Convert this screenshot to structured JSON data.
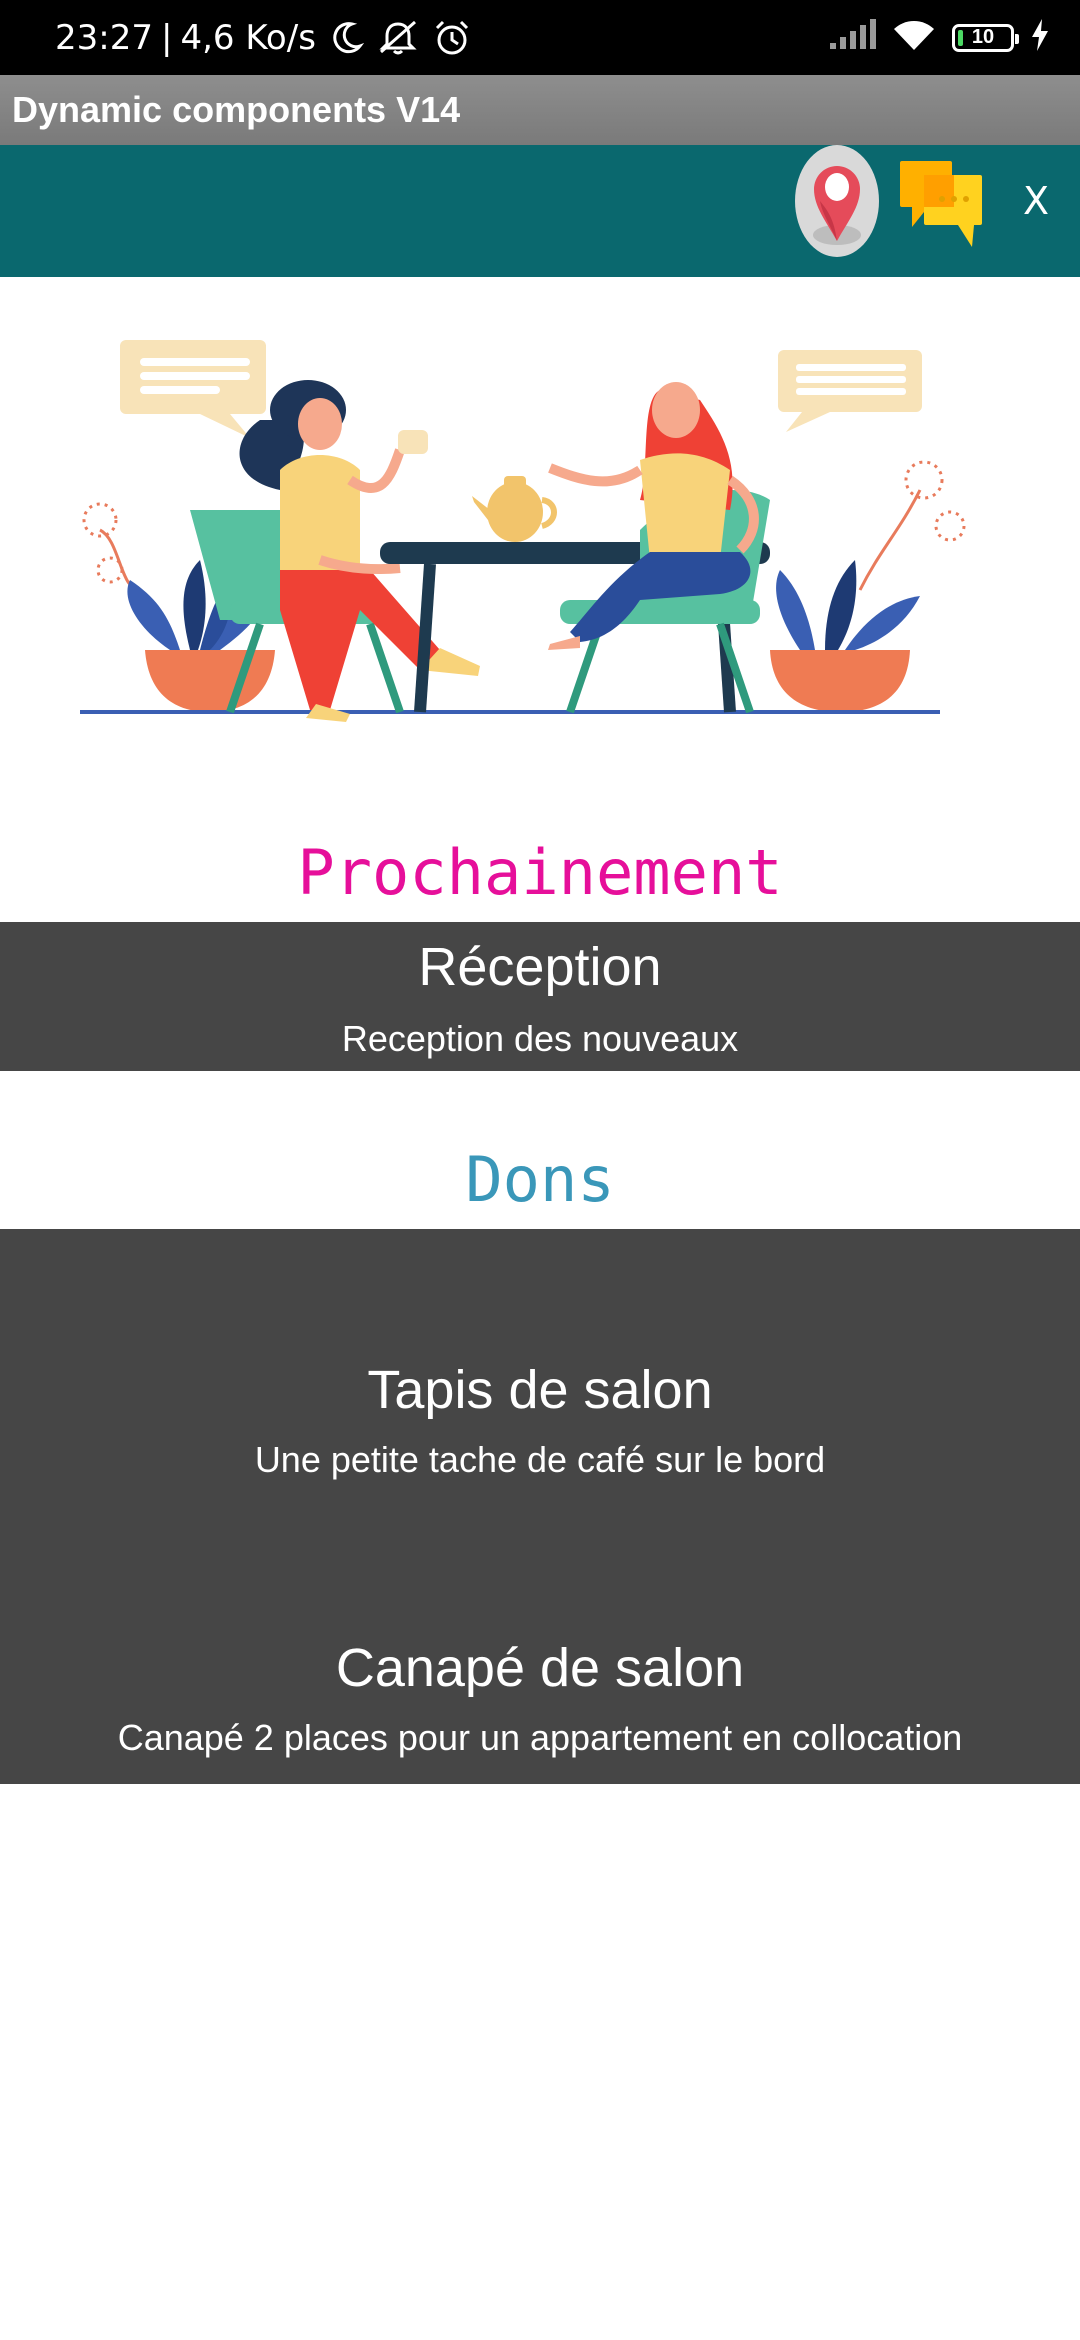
{
  "status_bar": {
    "time": "23:27",
    "separator": "|",
    "speed": "4,6 Ko/s",
    "battery_level": "10",
    "icons": [
      "moon-icon",
      "notifications-off-icon",
      "alarm-icon",
      "signal-icon",
      "wifi-icon",
      "battery-icon",
      "charging-icon"
    ]
  },
  "app_bar": {
    "title": "Dynamic components V14"
  },
  "toolbar": {
    "icons": [
      "map-pin-icon",
      "chat-bubbles-icon"
    ],
    "close_label": "X",
    "background_color": "#0a686e"
  },
  "sections": {
    "upcoming": {
      "heading": "Prochainement",
      "heading_color": "#e60f9a",
      "item": {
        "title": "Réception",
        "description": "Reception des nouveaux"
      }
    },
    "donations": {
      "heading": "Dons",
      "heading_color": "#3a97b9",
      "items": [
        {
          "title": "Tapis de salon",
          "description": "Une petite tache de café sur le bord"
        },
        {
          "title": "Canapé de salon",
          "description": "Canapé 2 places pour un appartement en collocation"
        }
      ]
    }
  },
  "colors": {
    "card_background": "#464646",
    "status_bar": "#000000",
    "app_bar": "#858585"
  }
}
